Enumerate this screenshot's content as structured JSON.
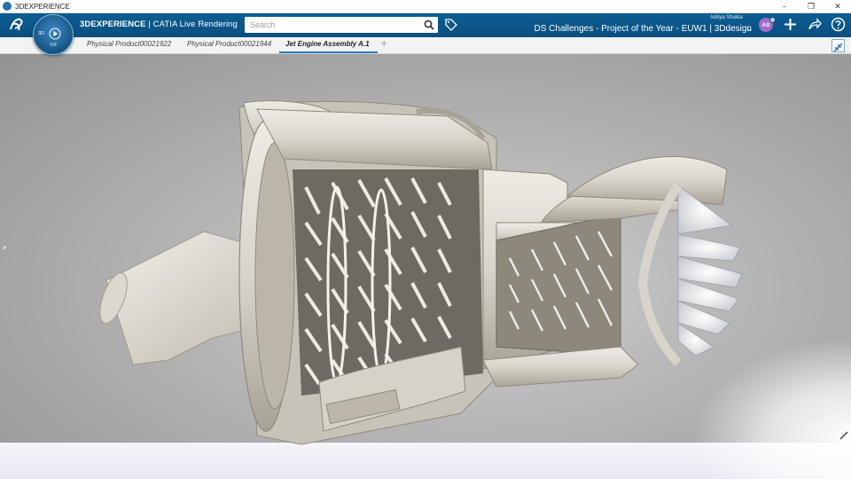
{
  "window": {
    "title": "3DEXPERIENCE",
    "controls": [
      "–",
      "❐",
      "✕"
    ]
  },
  "topbar": {
    "brand_bold": "3DEXPERIENCE",
    "brand_rest": " | CATIA ",
    "brand_app": "Live Rendering",
    "search_placeholder": "Search",
    "user_name": "Aditya Shukla",
    "avatar_initials": "AS",
    "project": "DS Challenges - Project of the Year - EUW1 | 3Ddesign",
    "compass": {
      "label_3d": "3D",
      "version": "V.R"
    }
  },
  "tabs": [
    {
      "label": "Physical Product00021922"
    },
    {
      "label": "Physical Product00021944"
    },
    {
      "label": "Jet Engine Assembly A.1"
    }
  ],
  "tab_add": "+",
  "colors": {
    "topbar": "#0a4f80",
    "accent": "#2a7ab9",
    "avatar": "#a46ccc",
    "model": "#dedad2"
  }
}
